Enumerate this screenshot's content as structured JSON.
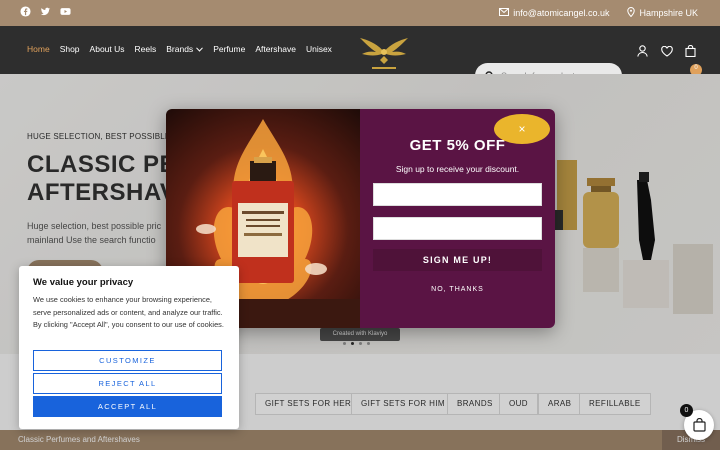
{
  "topbar": {
    "icons": [
      "facebook-icon",
      "twitter-icon",
      "youtube-icon"
    ],
    "email": "info@atomicangel.co.uk",
    "location": "Hampshire UK"
  },
  "nav": {
    "items": [
      {
        "label": "Home",
        "active": true
      },
      {
        "label": "Shop"
      },
      {
        "label": "About Us"
      },
      {
        "label": "Reels"
      },
      {
        "label": "Brands"
      },
      {
        "label": "Perfume"
      },
      {
        "label": "Aftershave"
      },
      {
        "label": "Unisex"
      }
    ],
    "search_placeholder": "Search for products...",
    "cart_count": "0"
  },
  "hero": {
    "subtitle": "HUGE SELECTION, BEST POSSIBLE P",
    "title_line1": "CLASSIC PEI",
    "title_line2": "AFTERSHAV",
    "text": "Huge selection, best possible pric mainland Use the search functio",
    "slider_credit": "Created with Klaviyo"
  },
  "popup": {
    "title": "GET 5% OFF",
    "subtitle": "Sign up to receive your discount.",
    "signup_label": "SIGN ME UP!",
    "decline_label": "NO, THANKS",
    "close_label": "×"
  },
  "cookie": {
    "title": "We value your privacy",
    "text": "We use cookies to enhance your browsing experience, serve personalized ads or content, and analyze our traffic. By clicking \"Accept All\", you consent to our use of cookies.",
    "customize_label": "CUSTOMIZE",
    "reject_label": "REJECT ALL",
    "accept_label": "ACCEPT ALL"
  },
  "categories": {
    "chips": [
      "X",
      "GIFT SETS FOR HER",
      "GIFT SETS FOR HIM",
      "BRANDS",
      "OUD",
      "ARAB",
      "REFILLABLE"
    ]
  },
  "footer": {
    "text": "Classic Perfumes and Aftershaves",
    "dismiss": "Dismiss",
    "fab_count": "0"
  },
  "colors": {
    "brand_gold": "#a58b70",
    "nav_dark": "#2e2e2e",
    "popup_purple": "#5a1444",
    "accent_yellow": "#eab52c",
    "cookie_blue": "#1863dc"
  }
}
